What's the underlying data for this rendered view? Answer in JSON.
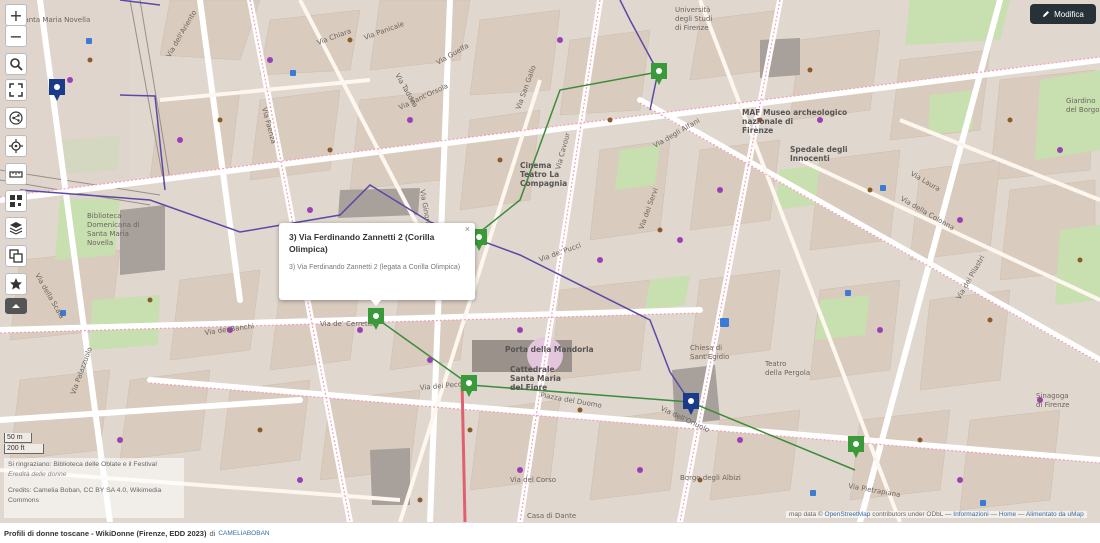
{
  "controls": {
    "zoom_in": "+",
    "zoom_out": "−",
    "icons": [
      "search-icon",
      "fullscreen-icon",
      "share-icon",
      "locate-icon",
      "measure-icon",
      "embed-icon",
      "layers-icon",
      "datalayers-icon",
      "star-icon",
      "collapse-icon"
    ]
  },
  "edit_button": {
    "label": "Modifica",
    "icon": "pencil-icon"
  },
  "popup": {
    "title": "3) Via Ferdinando Zannetti 2 (Corilla Olimpica)",
    "description": "3) Via Ferdinando Zannetti 2 (legata a Corilla Olimpica)",
    "close": "×"
  },
  "scale": {
    "metric": "50 m",
    "imperial": "200 ft"
  },
  "credits": {
    "line1": "Si ringraziano: Biblioteca delle Oblate e il Festival",
    "line1_italic": "Eredità delle donne",
    "line2": "Credits: Camelia Boban, CC BY SA 4.0, Wikimedia Commons"
  },
  "attribution": {
    "prefix": "map data ©",
    "osm": "OpenStreetMap",
    "middle": "contributors under ODbL —",
    "info": "Informazioni",
    "dash1": "—",
    "home": "Home",
    "dash2": "—",
    "umap": "Alimentato da uMap"
  },
  "footer": {
    "title": "Profili di donne toscane - WikiDonne (Firenze, EDD 2023)",
    "by": "di",
    "author": "CAMELIABOBAN"
  },
  "colors": {
    "marker_green": "#3a9a3a",
    "marker_blue": "#1a3a8a",
    "route_green": "#3c8c3c",
    "route_purple": "#5a4aa8",
    "edit_bg": "#263238"
  },
  "map_labels": {
    "santa_maria_novella": "Santa Maria Novella",
    "via_dell_ariento": "Via dell'Ariento",
    "via_panicale": "Via Panicale",
    "via_chiara": "Via Chiara",
    "via_faenza": "Via Faenza",
    "via_taddea": "Via Taddea",
    "via_guelfa": "Via Guelfa",
    "via_sant_orsola": "Via Sant'Orsola",
    "via_ginori": "Via Ginori",
    "via_san_gallo": "Via San Gallo",
    "via_cavour": "Via Cavour",
    "via_dei_servi": "Via dei Servi",
    "via_della_scala": "Via della Scala",
    "via_palazzuolo": "Via Palazzuolo",
    "via_dei_banchi": "Via dei Banchi",
    "via_de_cerretani": "Via de' Cerretani",
    "via_dei_pecori": "Via dei Pecori",
    "via_del_corso": "Via del Corso",
    "via_degli_alfani": "Via degli Alfani",
    "via_dei_pucci": "Via de' Pucci",
    "via_della_colonna": "Via della Colonna",
    "via_laura": "Via Laura",
    "via_dell_oriuolo": "Via dell'Oriuolo",
    "via_dei_pilastri": "Via dei Pilastri",
    "piazza_del_duomo": "Piazza del Duomo",
    "porta_della_mandorla": "Porta della Mandorla",
    "cattedrale": "Cattedrale\nSanta Maria\ndel Fiore",
    "spedale": "Spedale degli\nInnocenti",
    "maf": "MAF Museo archeologico\nnazionale di\nFirenze",
    "universita": "Università\ndegli Studi\ndi Firenze",
    "giardino_boboli": "Giardino\ndel Borgo",
    "biblioteca_domenicana": "Biblioteca\nDomenicana di\nSanta Maria\nNovella",
    "cinema": "Cinema\nTeatro La\nCompagnia",
    "chiesa_sant_egidio": "Chiesa di\nSant'Egidio",
    "teatro_pergola": "Teatro\ndella Pergola",
    "sinagoga": "Sinagoga\ndi Firenze",
    "casa_di_dante": "Casa di Dante",
    "borgo_degli_albizi": "Borgo degli Albizi",
    "via_pietrapiana": "Via Pietrapiana"
  }
}
